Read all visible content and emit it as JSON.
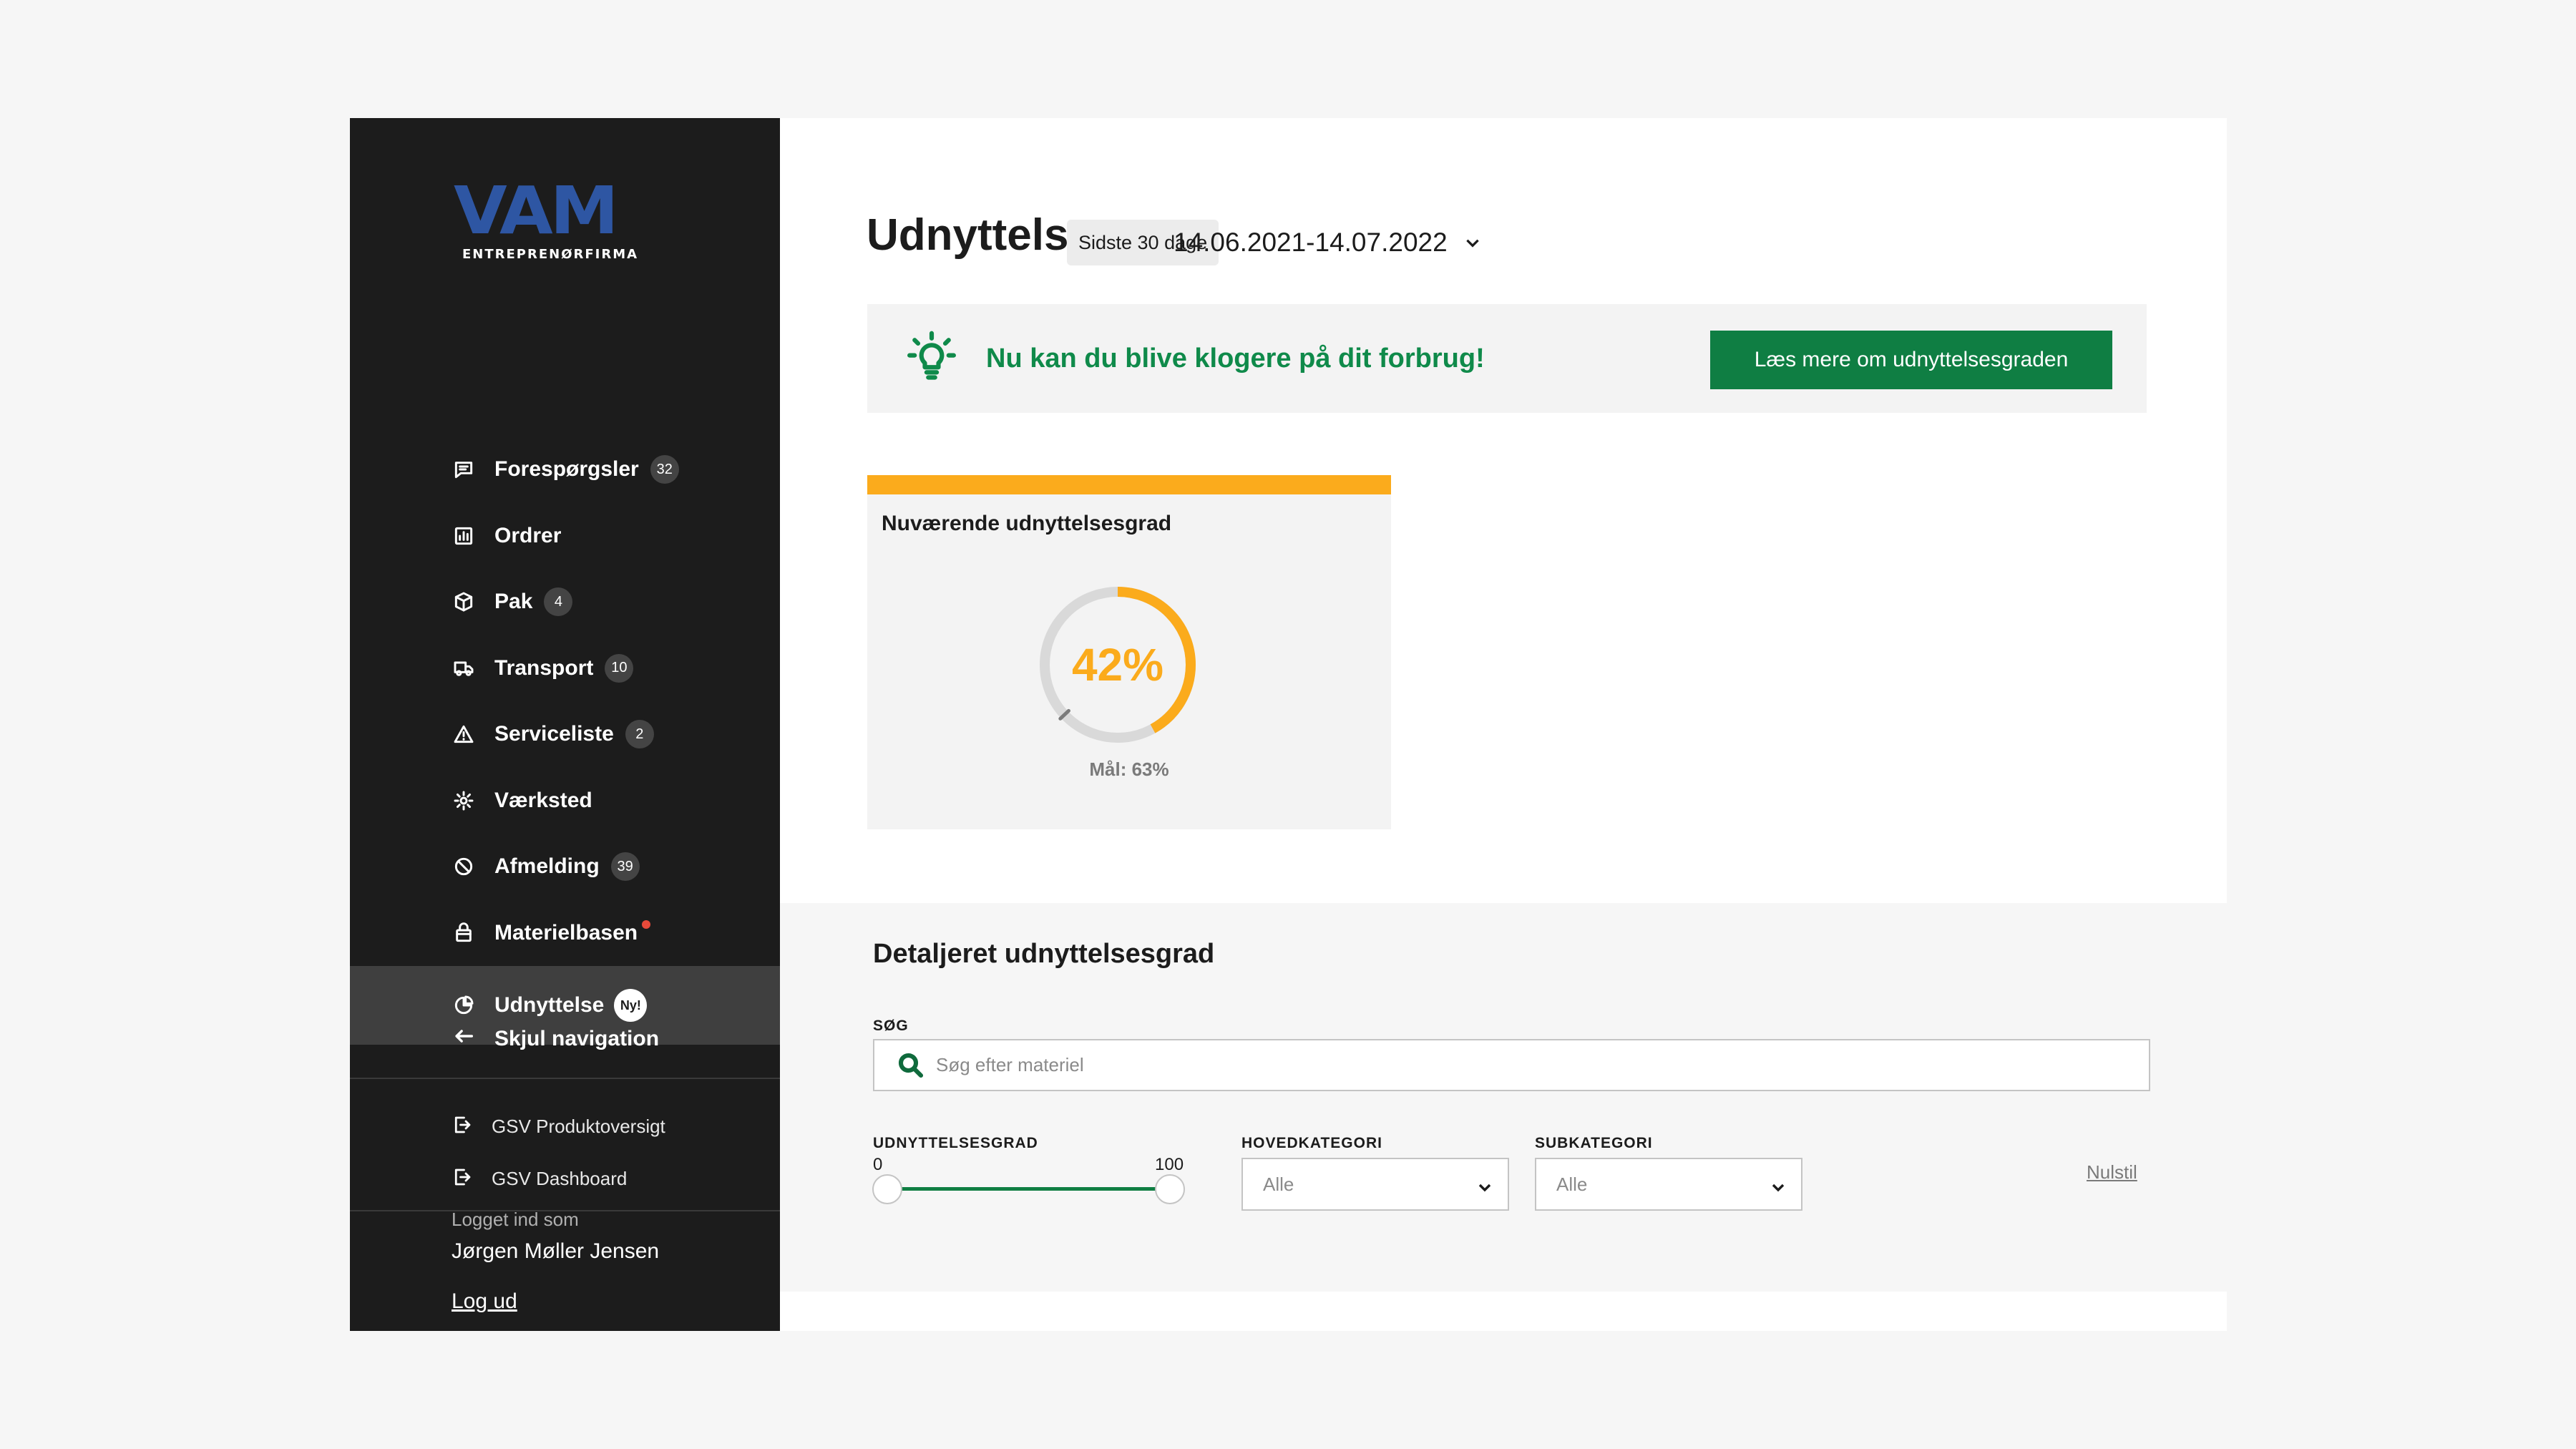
{
  "logo": {
    "main": "VAM",
    "sub": "ENTREPRENØRFIRMA"
  },
  "sidebar": {
    "items": [
      {
        "label": "Forespørgsler",
        "badge": "32",
        "icon": "chat-icon"
      },
      {
        "label": "Ordrer",
        "badge": "",
        "icon": "chart-icon"
      },
      {
        "label": "Pak",
        "badge": "4",
        "icon": "package-icon"
      },
      {
        "label": "Transport",
        "badge": "10",
        "icon": "truck-icon"
      },
      {
        "label": "Serviceliste",
        "badge": "2",
        "icon": "warning-icon"
      },
      {
        "label": "Værksted",
        "badge": "",
        "icon": "gear-icon"
      },
      {
        "label": "Afmelding",
        "badge": "39",
        "icon": "block-icon"
      },
      {
        "label": "Materielbasen",
        "badge": "",
        "icon": "bag-icon"
      },
      {
        "label": "Udnyttelse",
        "badge": "Ny!",
        "icon": "pie-icon"
      }
    ],
    "hide_nav": "Skjul navigation",
    "external": [
      {
        "label": "GSV Produktoversigt"
      },
      {
        "label": "GSV Dashboard"
      }
    ],
    "logged_in_label": "Logget ind som",
    "user_name": "Jørgen Møller Jensen",
    "logout": "Log ud"
  },
  "header": {
    "title": "Udnyttelse",
    "range_chip": "Sidste 30 dage",
    "date_range": "14.06.2021-14.07.2022"
  },
  "banner": {
    "text": "Nu kan du blive klogere på dit forbrug!",
    "button": "Læs mere om udnyttelsesgraden",
    "color": "#0f8a4a"
  },
  "card": {
    "title": "Nuværende udnyttelsesgrad",
    "value": "42%",
    "value_fraction": 0.42,
    "goal_label": "Mål: 63%",
    "goal_fraction": 0.63,
    "accent": "#fbab1c"
  },
  "detail": {
    "title": "Detaljeret udnyttelsesgrad",
    "search_label": "SØG",
    "search_placeholder": "Søg efter materiel",
    "slider_label": "UDNYTTELSESGRAD",
    "slider_min": "0",
    "slider_max": "100",
    "main_category_label": "HOVEDKATEGORI",
    "main_category_value": "Alle",
    "sub_category_label": "SUBKATEGORI",
    "sub_category_value": "Alle",
    "reset": "Nulstil"
  }
}
